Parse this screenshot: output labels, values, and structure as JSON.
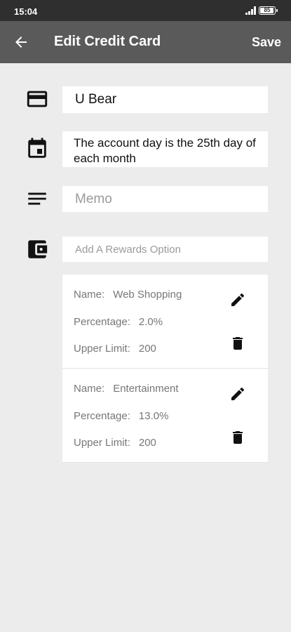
{
  "status_bar": {
    "time": "15:04",
    "battery": "85"
  },
  "app_bar": {
    "title": "Edit Credit Card",
    "save_label": "Save"
  },
  "form": {
    "card_name": "U Bear",
    "account_day_text": "The account day is the 25th day of each month",
    "memo_placeholder": "Memo",
    "rewards_placeholder": "Add A Rewards Option"
  },
  "rewards": [
    {
      "name_label": "Name:",
      "name": "Web Shopping",
      "percentage_label": "Percentage:",
      "percentage": "2.0%",
      "limit_label": "Upper Limit:",
      "limit": "200"
    },
    {
      "name_label": "Name:",
      "name": "Entertainment",
      "percentage_label": "Percentage:",
      "percentage": "13.0%",
      "limit_label": "Upper Limit:",
      "limit": "200"
    }
  ],
  "icons": {
    "back": "arrow-back-icon",
    "card": "credit-card-icon",
    "calendar": "calendar-icon",
    "memo": "notes-icon",
    "wallet": "wallet-icon",
    "edit": "pencil-icon",
    "delete": "trash-icon"
  },
  "colors": {
    "status_bar": "#2f2f2f",
    "app_bar": "#5a5a5a",
    "background": "#ececec"
  }
}
